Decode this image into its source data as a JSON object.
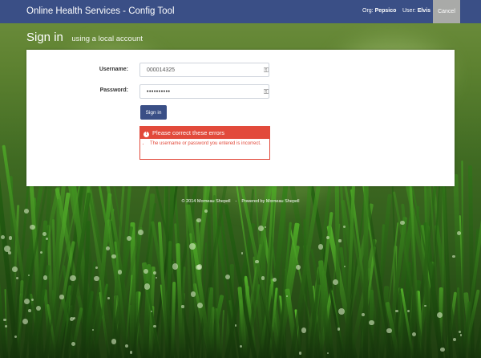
{
  "app": {
    "title": "Online Health Services - Config Tool",
    "org_label": "Org:",
    "org_value": "Pepsico",
    "user_label": "User:",
    "user_value": "Elvis",
    "cancel_label": "Cancel"
  },
  "heading": {
    "title": "Sign in",
    "subtitle": "using a local account"
  },
  "form": {
    "username_label": "Username:",
    "username_value": "000014325",
    "password_label": "Password:",
    "password_value": "••••••••••",
    "signin_label": "Sign in"
  },
  "error": {
    "title": "Please correct these errors",
    "messages": [
      "The username or password you entered is incorrect."
    ]
  },
  "footer": {
    "copyright": "© 2014 Morneau Shepell",
    "separator": "-",
    "powered": "Powered by Morneau Shepell"
  },
  "colors": {
    "brand": "#3a4f86",
    "error": "#e24a3b",
    "cancel": "#a9aaa8"
  },
  "icons": [
    "key-icon",
    "exclamation-icon"
  ]
}
